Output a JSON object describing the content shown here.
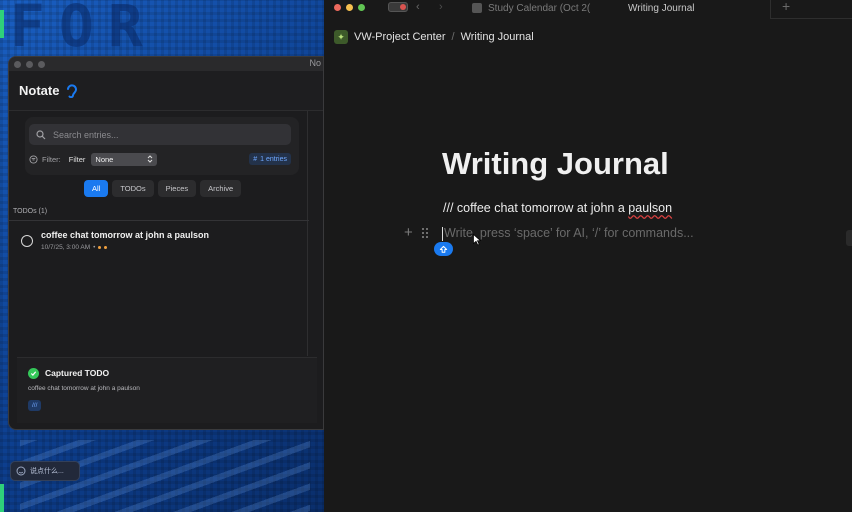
{
  "notate": {
    "window_title": "No",
    "app_title": "Notate",
    "search": {
      "placeholder": "Search entries..."
    },
    "filter": {
      "muted_label": "Filter:",
      "label": "Filter",
      "selected": "None",
      "entries_count": "1 entries"
    },
    "tabs": [
      {
        "label": "All",
        "active": true
      },
      {
        "label": "TODOs",
        "active": false
      },
      {
        "label": "Pieces",
        "active": false
      },
      {
        "label": "Archive",
        "active": false
      }
    ],
    "section_label": "TODOs (1)",
    "todo": {
      "title": "coffee chat tomorrow at john a paulson",
      "timestamp": "10/7/25, 3:00 AM",
      "separator": "•"
    },
    "toast": {
      "title": "Captured TODO",
      "body": "coffee chat tomorrow at john a paulson",
      "tag": "///"
    }
  },
  "desktop": {
    "blocks_text": "FOR",
    "chat_placeholder": "说点什么..."
  },
  "editor": {
    "tabs": [
      {
        "label": "Study Calendar (Oct 2(",
        "active": false
      },
      {
        "label": "Writing Journal",
        "active": true
      }
    ],
    "new_tab_symbol": "+",
    "breadcrumb": {
      "workspace": "VW-Project Center",
      "separator": "/",
      "page": "Writing Journal"
    },
    "title": "Writing Journal",
    "paragraph_prefix": "/// coffee chat tomorrow at john a ",
    "paragraph_squiggle": "paulson",
    "placeholder": "Write, press ‘space’ for AI, ‘/’ for commands...",
    "add_block_symbol": "+"
  },
  "colors": {
    "accent_blue": "#1a7af0",
    "success_green": "#34c759",
    "editor_bg": "#191919",
    "notate_bg": "#1c1c1e",
    "desktop_blue": "#0d3f8f"
  }
}
